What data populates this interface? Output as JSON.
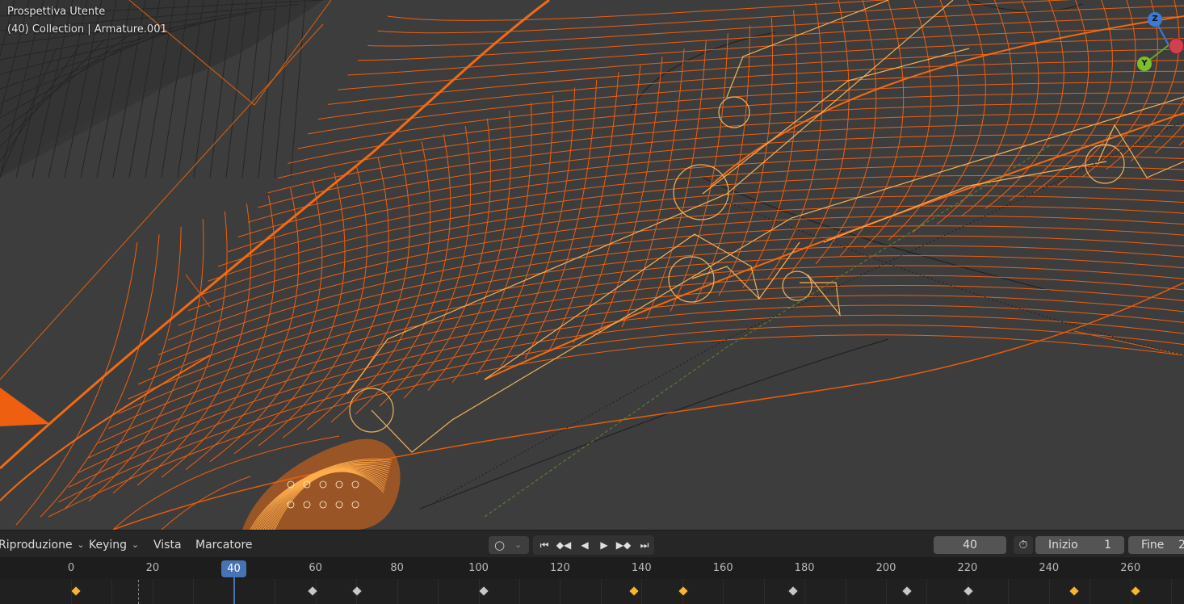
{
  "viewport": {
    "title": "Prospettiva Utente",
    "subtitle": "(40) Collection | Armature.001",
    "gizmo": {
      "z": "Z",
      "y": "Y"
    }
  },
  "timeline": {
    "menus": {
      "playback": "Riproduzione",
      "keying": "Keying",
      "view": "Vista",
      "marker": "Marcatore"
    },
    "current_frame": "40",
    "start_label": "Inizio",
    "start_value": "1",
    "end_label": "Fine",
    "end_value": "2",
    "ruler_labels": [
      "0",
      "20",
      "40",
      "60",
      "80",
      "100",
      "120",
      "140",
      "160",
      "180",
      "200",
      "220",
      "240",
      "260"
    ],
    "cursor_label": "40",
    "keyframes_selected": [
      1,
      138,
      150,
      246,
      261
    ],
    "keyframes_unselected": [
      59,
      70,
      101,
      177,
      205,
      220
    ],
    "colors": {
      "accent": "#4772b3",
      "wire": "#f06a1a",
      "bone": "#f2b25a",
      "key_selected": "#f5b730",
      "key_unselected": "#c8c8c8"
    }
  }
}
